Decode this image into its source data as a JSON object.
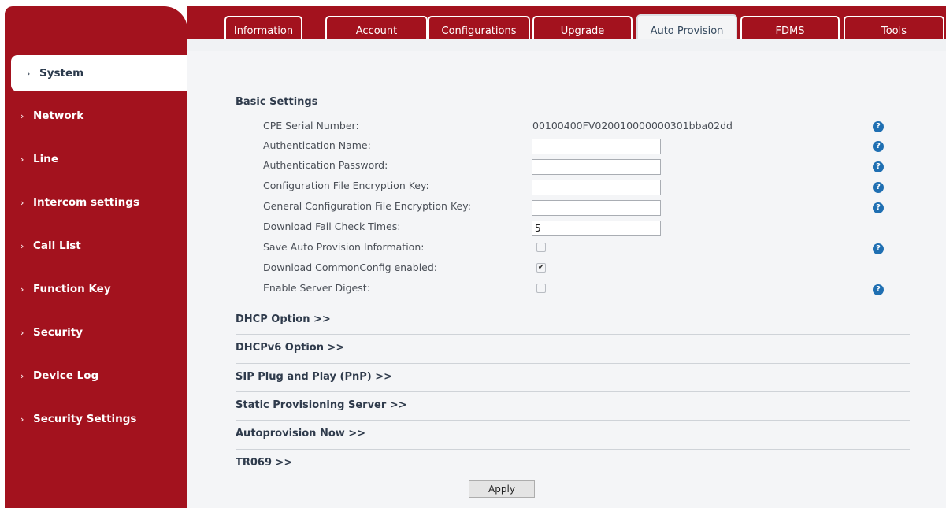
{
  "tabs": [
    {
      "label": "Information"
    },
    {
      "label": "Account"
    },
    {
      "label": "Configurations"
    },
    {
      "label": "Upgrade"
    },
    {
      "label": "Auto Provision"
    },
    {
      "label": "FDMS"
    },
    {
      "label": "Tools"
    }
  ],
  "active_tab": "Auto Provision",
  "sidebar": {
    "items": [
      {
        "label": "System",
        "chevron": "›"
      },
      {
        "label": "Network",
        "chevron": "›"
      },
      {
        "label": "Line",
        "chevron": "›"
      },
      {
        "label": "Intercom settings",
        "chevron": "›"
      },
      {
        "label": "Call List",
        "chevron": "›"
      },
      {
        "label": "Function Key",
        "chevron": "›"
      },
      {
        "label": "Security",
        "chevron": "›"
      },
      {
        "label": "Device Log",
        "chevron": "›"
      },
      {
        "label": "Security Settings",
        "chevron": "›"
      }
    ],
    "active": "System"
  },
  "basic_settings": {
    "title": "Basic Settings",
    "rows": [
      {
        "label": "CPE Serial Number:",
        "value": "00100400FV020010000000301bba02dd",
        "help": true
      },
      {
        "label": "Authentication Name:",
        "value": "",
        "help": true
      },
      {
        "label": "Authentication Password:",
        "value": "",
        "help": true
      },
      {
        "label": "Configuration File Encryption Key:",
        "value": "",
        "help": true
      },
      {
        "label": "General Configuration File Encryption Key:",
        "value": "",
        "help": true
      },
      {
        "label": "Download Fail Check Times:",
        "value": "5",
        "help": false
      },
      {
        "label": "Save Auto Provision Information:",
        "checked": false,
        "help": true
      },
      {
        "label": "Download CommonConfig enabled:",
        "checked": true,
        "help": false
      },
      {
        "label": "Enable Server Digest:",
        "checked": false,
        "help": true
      }
    ]
  },
  "help_symbol": "?",
  "check_symbol": "✔",
  "sections": [
    {
      "label": "DHCP Option >>"
    },
    {
      "label": "DHCPv6 Option >>"
    },
    {
      "label": "SIP Plug and Play (PnP) >>"
    },
    {
      "label": "Static Provisioning Server >>"
    },
    {
      "label": "Autoprovision Now >>"
    },
    {
      "label": "TR069 >>"
    }
  ],
  "apply_label": "Apply",
  "colors": {
    "brand": "#a3121e",
    "help": "#1f6fb2",
    "background": "#f4f5f7"
  }
}
